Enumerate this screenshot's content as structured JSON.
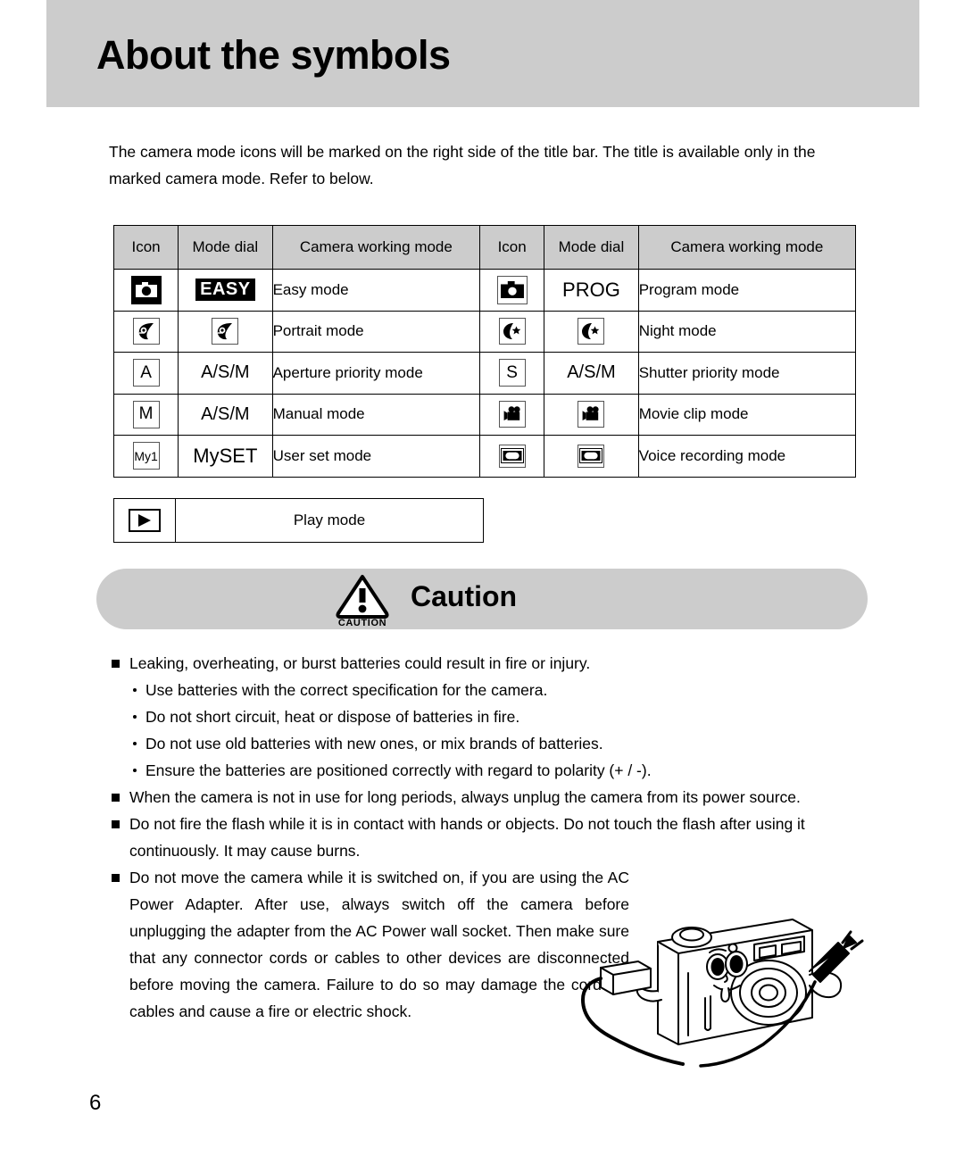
{
  "page": {
    "title": "About the symbols",
    "number": "6",
    "intro": "The camera mode icons will be marked on the right side of the title bar. The title is available only in the marked camera mode. Refer to below.",
    "accent_gray": "#cccccc"
  },
  "mode_table": {
    "headers": [
      "Icon",
      "Mode dial",
      "Camera working mode",
      "Icon",
      "Mode dial",
      "Camera working mode"
    ],
    "rows": [
      {
        "left": {
          "icon": "camera-inverted-icon",
          "icon_text": "",
          "dial": "EASY",
          "dial_style": "easy-tag",
          "mode": "Easy mode"
        },
        "right": {
          "icon": "camera-icon",
          "icon_text": "",
          "dial": "PROG",
          "dial_style": "text",
          "mode": "Program mode"
        }
      },
      {
        "left": {
          "icon": "portrait-face-icon",
          "icon_text": "",
          "dial": "",
          "dial_style": "portrait-face-icon",
          "mode": "Portrait mode"
        },
        "right": {
          "icon": "night-moon-star-icon",
          "icon_text": "",
          "dial": "",
          "dial_style": "night-moon-star-icon",
          "mode": "Night mode"
        }
      },
      {
        "left": {
          "icon": "letter-a-icon",
          "icon_text": "A",
          "dial": "A/S/M",
          "dial_style": "text",
          "mode": "Aperture priority mode"
        },
        "right": {
          "icon": "letter-s-icon",
          "icon_text": "S",
          "dial": "A/S/M",
          "dial_style": "text",
          "mode": "Shutter priority mode"
        }
      },
      {
        "left": {
          "icon": "letter-m-icon",
          "icon_text": "M",
          "dial": "A/S/M",
          "dial_style": "text",
          "mode": "Manual mode"
        },
        "right": {
          "icon": "movie-camera-icon",
          "icon_text": "",
          "dial": "",
          "dial_style": "movie-camera-icon",
          "mode": "Movie clip mode"
        }
      },
      {
        "left": {
          "icon": "my1-icon",
          "icon_text": "My1",
          "dial": "MySET",
          "dial_style": "text",
          "mode": "User set mode"
        },
        "right": {
          "icon": "voice-recorder-icon",
          "icon_text": "",
          "dial": "",
          "dial_style": "voice-recorder-icon",
          "mode": "Voice recording mode"
        }
      }
    ]
  },
  "play_row": {
    "icon": "play-triangle-icon",
    "label": "Play mode"
  },
  "caution": {
    "banner_label": "Caution",
    "icon_label": "CAUTION",
    "items": [
      {
        "level": "main",
        "text": "Leaking, overheating, or burst batteries could result in fire or injury."
      },
      {
        "level": "sub",
        "text": "Use batteries with the correct specification for the camera."
      },
      {
        "level": "sub",
        "text": "Do not short circuit, heat or dispose of batteries in fire."
      },
      {
        "level": "sub",
        "text": "Do not use old batteries with new ones, or mix brands of batteries."
      },
      {
        "level": "sub",
        "text": "Ensure the batteries are positioned correctly with regard to polarity (+ / -)."
      },
      {
        "level": "main",
        "text": "When the camera is not in use for long periods, always unplug the camera from its power source."
      },
      {
        "level": "main",
        "text": "Do not fire the flash while it is in contact with hands or objects. Do not touch the flash after using it continuously. It may cause burns."
      },
      {
        "level": "main-narrow",
        "text": "Do not move the camera while it is switched on, if you are using the AC Power Adapter. After use, always switch off the camera before unplugging the adapter from the AC Power wall socket. Then make sure that any connector cords or cables to other devices are disconnected before moving the camera. Failure to do so may damage the cords or cables and cause a fire or electric shock."
      }
    ]
  },
  "illustration": {
    "name": "cartoon-camera-with-ac-adapter"
  }
}
